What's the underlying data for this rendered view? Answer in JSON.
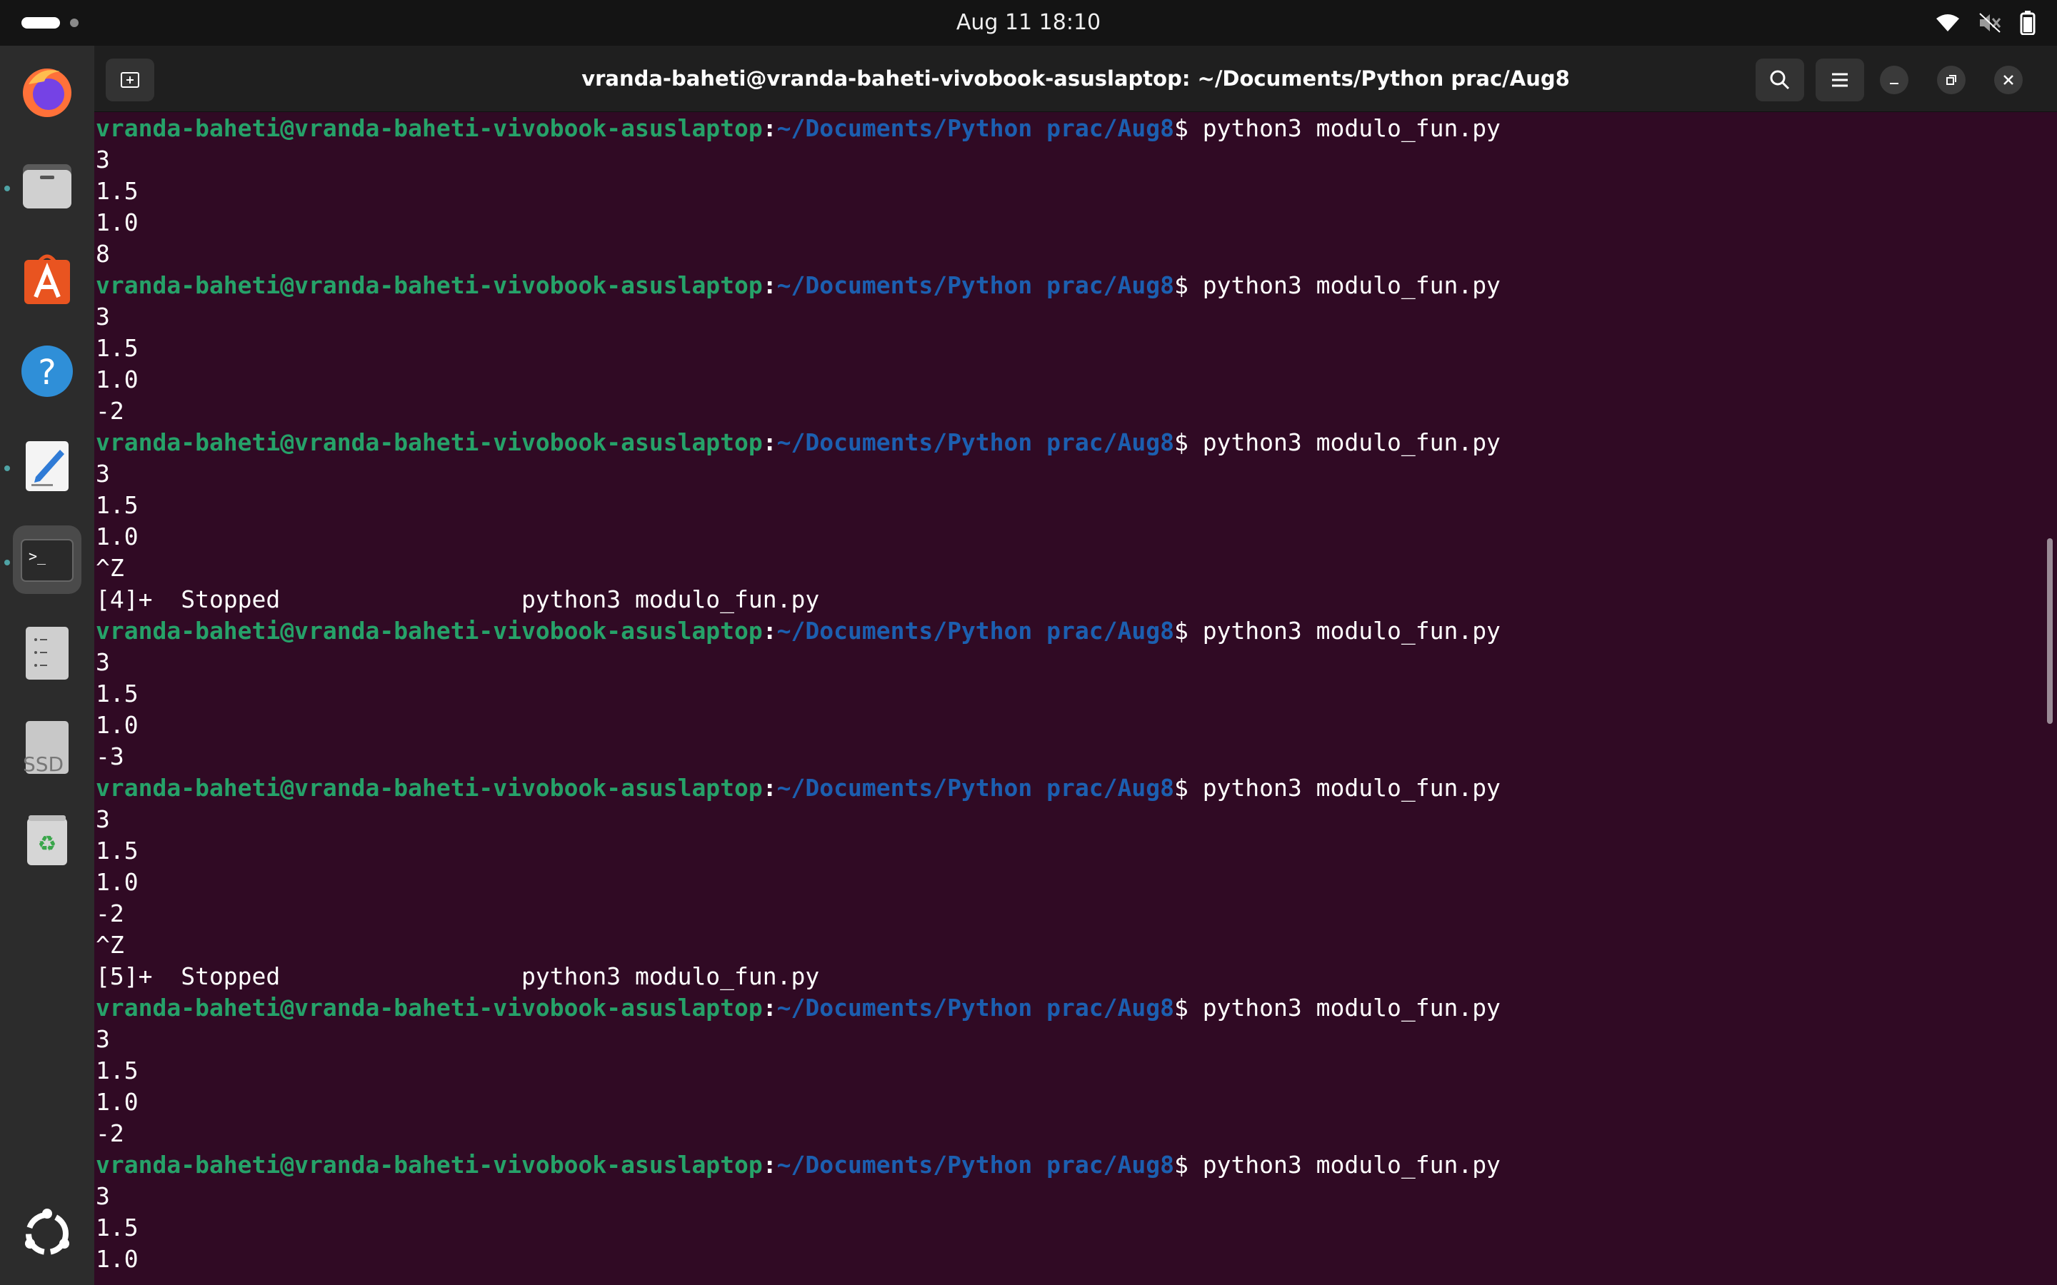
{
  "topbar": {
    "clock": "Aug 11  18:10",
    "icons": [
      "wifi-icon",
      "volume-muted-icon",
      "battery-icon"
    ]
  },
  "dock": {
    "items": [
      {
        "name": "firefox-icon",
        "running": false
      },
      {
        "name": "files-icon",
        "running": true
      },
      {
        "name": "app-center-icon",
        "running": false
      },
      {
        "name": "help-icon",
        "running": false
      },
      {
        "name": "text-editor-icon",
        "running": true
      },
      {
        "name": "terminal-icon",
        "running": true,
        "active": true
      },
      {
        "name": "drive-icon",
        "running": false
      },
      {
        "name": "ssd-icon",
        "running": false,
        "label": "SSD"
      },
      {
        "name": "trash-icon",
        "running": false
      }
    ],
    "show_apps": "ubuntu-logo-icon"
  },
  "window": {
    "title": "vranda-baheti@vranda-baheti-vivobook-asuslaptop: ~/Documents/Python prac/Aug8"
  },
  "colors": {
    "terminal_bg": "#300a24",
    "prompt_user": "#26a269",
    "prompt_path": "#1c5fb0"
  },
  "terminal": {
    "prompt_user": "vranda-baheti@vranda-baheti-vivobook-asuslaptop",
    "prompt_path": "~/Documents/Python prac/Aug8",
    "prompt_symbol": "$ ",
    "lines": [
      {
        "type": "prompt",
        "cmd": "python3 modulo_fun.py"
      },
      {
        "type": "out",
        "text": "3"
      },
      {
        "type": "out",
        "text": "1.5"
      },
      {
        "type": "out",
        "text": "1.0"
      },
      {
        "type": "out",
        "text": "8"
      },
      {
        "type": "prompt",
        "cmd": "python3 modulo_fun.py"
      },
      {
        "type": "out",
        "text": "3"
      },
      {
        "type": "out",
        "text": "1.5"
      },
      {
        "type": "out",
        "text": "1.0"
      },
      {
        "type": "out",
        "text": "-2"
      },
      {
        "type": "prompt",
        "cmd": "python3 modulo_fun.py"
      },
      {
        "type": "out",
        "text": "3"
      },
      {
        "type": "out",
        "text": "1.5"
      },
      {
        "type": "out",
        "text": "1.0"
      },
      {
        "type": "out",
        "text": "^Z"
      },
      {
        "type": "out",
        "text": "[4]+  Stopped                 python3 modulo_fun.py"
      },
      {
        "type": "prompt",
        "cmd": "python3 modulo_fun.py"
      },
      {
        "type": "out",
        "text": "3"
      },
      {
        "type": "out",
        "text": "1.5"
      },
      {
        "type": "out",
        "text": "1.0"
      },
      {
        "type": "out",
        "text": "-3"
      },
      {
        "type": "prompt",
        "cmd": "python3 modulo_fun.py"
      },
      {
        "type": "out",
        "text": "3"
      },
      {
        "type": "out",
        "text": "1.5"
      },
      {
        "type": "out",
        "text": "1.0"
      },
      {
        "type": "out",
        "text": "-2"
      },
      {
        "type": "out",
        "text": "^Z"
      },
      {
        "type": "out",
        "text": "[5]+  Stopped                 python3 modulo_fun.py"
      },
      {
        "type": "prompt",
        "cmd": "python3 modulo_fun.py"
      },
      {
        "type": "out",
        "text": "3"
      },
      {
        "type": "out",
        "text": "1.5"
      },
      {
        "type": "out",
        "text": "1.0"
      },
      {
        "type": "out",
        "text": "-2"
      },
      {
        "type": "prompt",
        "cmd": "python3 modulo_fun.py"
      },
      {
        "type": "out",
        "text": "3"
      },
      {
        "type": "out",
        "text": "1.5"
      },
      {
        "type": "out",
        "text": "1.0"
      }
    ]
  }
}
